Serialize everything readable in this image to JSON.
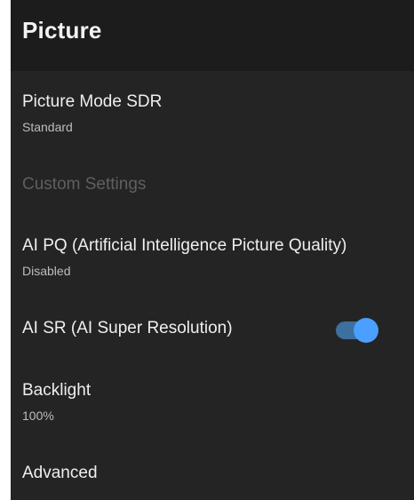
{
  "header": {
    "title": "Picture"
  },
  "items": {
    "picture_mode": {
      "title": "Picture Mode SDR",
      "value": "Standard"
    },
    "custom_settings": {
      "label": "Custom Settings"
    },
    "ai_pq": {
      "title": "AI PQ (Artificial Intelligence Picture Quality)",
      "value": "Disabled"
    },
    "ai_sr": {
      "title": "AI SR (AI Super Resolution)",
      "enabled": true
    },
    "backlight": {
      "title": "Backlight",
      "value": "100%"
    },
    "advanced": {
      "title": "Advanced"
    }
  },
  "colors": {
    "background": "#242424",
    "header_background": "#1c1c1c",
    "toggle_on": "#4a9fff",
    "toggle_track_on": "#3d6f9f"
  }
}
